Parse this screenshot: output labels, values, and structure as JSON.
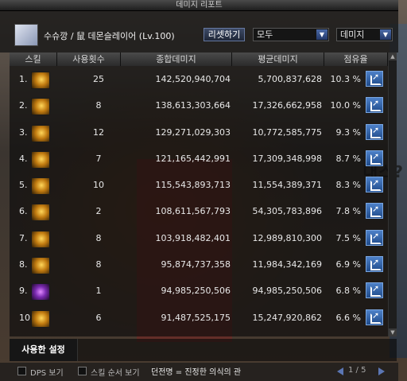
{
  "window": {
    "title": "데미지 리포트"
  },
  "header": {
    "character": "수슈깡 / 鼠 데몬슬레이어 (Lv.100)",
    "reset_label": "리셋하기",
    "mode_select": "모두",
    "type_select": "데미지"
  },
  "table": {
    "columns": [
      "스킬",
      "사용횟수",
      "종합데미지",
      "평균데미지",
      "점유율"
    ],
    "rows": [
      {
        "rank": "1.",
        "count": "25",
        "total": "142,520,940,704",
        "avg": "5,700,837,628",
        "share": "10.3 %",
        "icon": "skill-icon"
      },
      {
        "rank": "2.",
        "count": "8",
        "total": "138,613,303,664",
        "avg": "17,326,662,958",
        "share": "10.0 %",
        "icon": "skill-icon"
      },
      {
        "rank": "3.",
        "count": "12",
        "total": "129,271,029,303",
        "avg": "10,772,585,775",
        "share": "9.3 %",
        "icon": "skill-icon"
      },
      {
        "rank": "4.",
        "count": "7",
        "total": "121,165,442,991",
        "avg": "17,309,348,998",
        "share": "8.7 %",
        "icon": "skill-icon"
      },
      {
        "rank": "5.",
        "count": "10",
        "total": "115,543,893,713",
        "avg": "11,554,389,371",
        "share": "8.3 %",
        "icon": "skill-icon"
      },
      {
        "rank": "6.",
        "count": "2",
        "total": "108,611,567,793",
        "avg": "54,305,783,896",
        "share": "7.8 %",
        "icon": "skill-icon"
      },
      {
        "rank": "7.",
        "count": "8",
        "total": "103,918,482,401",
        "avg": "12,989,810,300",
        "share": "7.5 %",
        "icon": "skill-icon"
      },
      {
        "rank": "8.",
        "count": "8",
        "total": "95,874,737,358",
        "avg": "11,984,342,169",
        "share": "6.9 %",
        "icon": "skill-icon"
      },
      {
        "rank": "9.",
        "count": "1",
        "total": "94,985,250,506",
        "avg": "94,985,250,506",
        "share": "6.8 %",
        "icon": "skill-icon-purple"
      },
      {
        "rank": "10.",
        "count": "6",
        "total": "91,487,525,175",
        "avg": "15,247,920,862",
        "share": "6.6 %",
        "icon": "skill-icon"
      }
    ]
  },
  "footer": {
    "tab_label": "사용한 설정"
  },
  "bottom": {
    "dps_label": "DPS 보기",
    "order_label": "스킬 순서 보기",
    "title_text": "던전명 = 진정한 의식의 관",
    "page": "1 / 5"
  },
  "background": {
    "text": "대스?"
  },
  "colors": {
    "accent": "#4d80c8",
    "panel": "#0a0a0a"
  }
}
